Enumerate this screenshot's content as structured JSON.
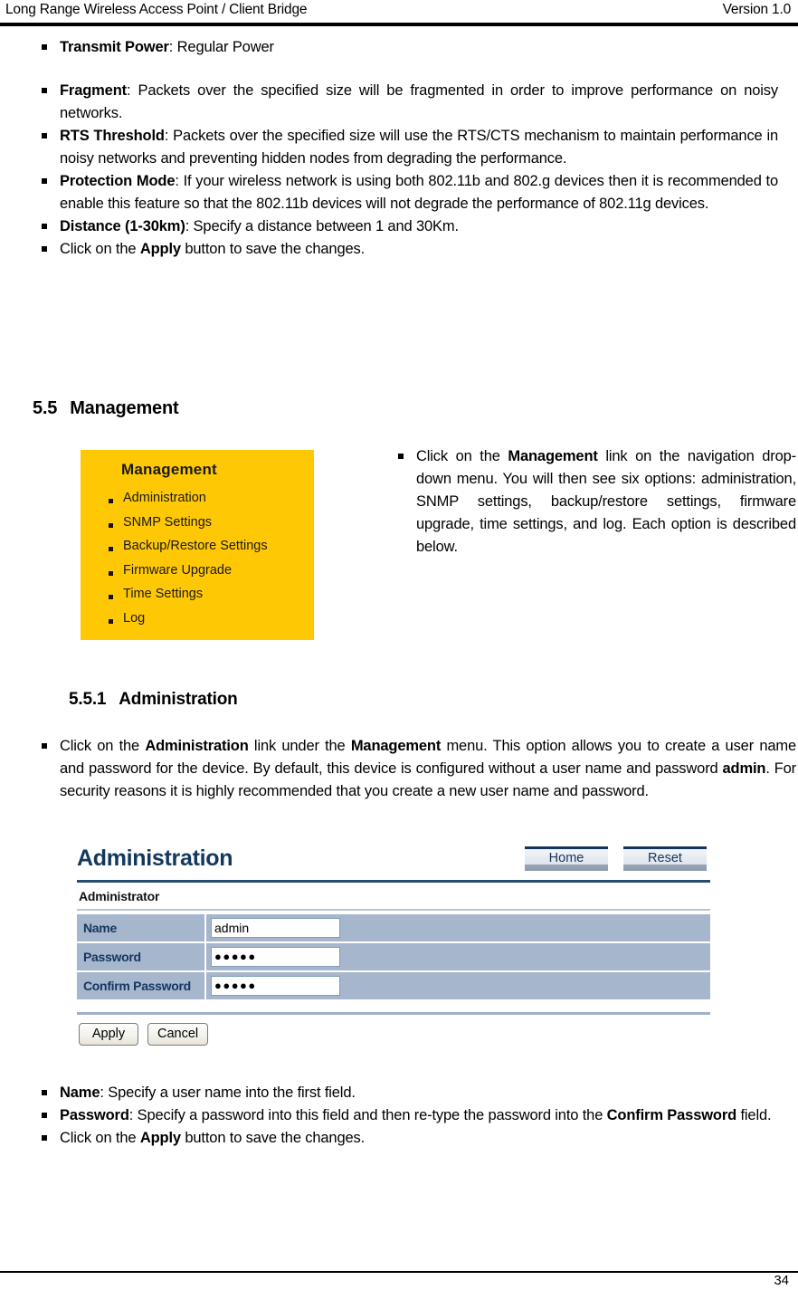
{
  "header": {
    "left_title": "Long Range Wireless Access Point / Client Bridge",
    "right_version": "Version 1.0"
  },
  "top_bullets": [
    {
      "bold": "Transmit Power",
      "rest": ": Regular Power"
    },
    {
      "bold": "Fragment",
      "rest": ": Packets over the specified size will be fragmented in order to improve performance on noisy networks."
    },
    {
      "bold": "RTS Threshold",
      "rest": ": Packets over the specified size will use the RTS/CTS mechanism to maintain performance in noisy networks and preventing hidden nodes from degrading the performance."
    },
    {
      "bold": "Protection Mode",
      "rest": ": If your wireless network is using both 802.11b and 802.g devices then it is recommended to enable this feature so that the 802.11b devices will not degrade the performance of 802.11g devices."
    },
    {
      "bold": "Distance (1-30km)",
      "rest": ": Specify a distance between 1 and 30Km."
    },
    {
      "prefix": "Click on the ",
      "bold": "Apply",
      "rest": " button to save the changes."
    }
  ],
  "section": {
    "number": "5.5",
    "title": "Management"
  },
  "management_screenshot": {
    "title": "Management",
    "items": [
      "Administration",
      "SNMP Settings",
      "Backup/Restore Settings",
      "Firmware Upgrade",
      "Time Settings",
      "Log"
    ],
    "background_color": "#FFC805"
  },
  "management_note": {
    "part1": "Click on the ",
    "bold": "Management",
    "part2": " link on the navigation drop-down menu. You will then see six options: administration, SNMP settings, backup/restore settings, firmware upgrade, time settings, and log. Each option is described below."
  },
  "subsection": {
    "number": "5.5.1",
    "title": "Administration"
  },
  "admin_paragraph": {
    "p1": "Click on the ",
    "b1": "Administration",
    "p2": " link under the ",
    "b2": "Management",
    "p3": " menu. This option allows you to create a user name and password for the device. By default, this device is configured without a user name and password ",
    "b3": "admin",
    "p4": ". For security reasons it is highly recommended that you create a new user name and password."
  },
  "admin_screenshot": {
    "title": "Administration",
    "home_button": "Home",
    "reset_button": "Reset",
    "section_label": "Administrator",
    "rows": [
      {
        "label": "Name",
        "value": "admin",
        "type": "text"
      },
      {
        "label": "Password",
        "value": "●●●●●",
        "type": "password"
      },
      {
        "label": "Confirm Password",
        "value": "●●●●●",
        "type": "password"
      }
    ],
    "apply_button": "Apply",
    "cancel_button": "Cancel",
    "title_color": "#13385e",
    "row_color": "#a6b6cd"
  },
  "closing_bullets": [
    {
      "bold": "Name",
      "rest": ": Specify a user name into the first field."
    },
    {
      "bold": "Password",
      "rest": ": Specify a password into this field and then re-type the password into the ",
      "bold2": "Confirm Password",
      "rest2": " field."
    },
    {
      "prefix": "Click on the ",
      "bold": "Apply",
      "rest": " button to save the changes."
    }
  ],
  "footer": {
    "page_number": "34"
  }
}
